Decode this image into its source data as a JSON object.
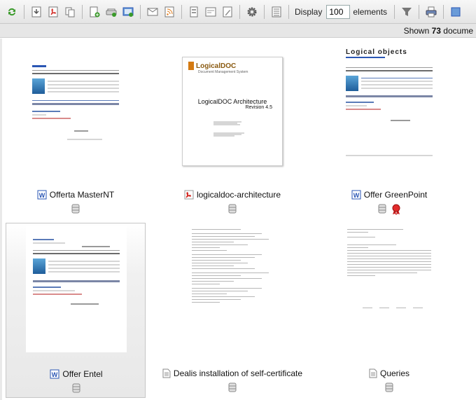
{
  "toolbar": {
    "display_label": "Display",
    "display_value": "100",
    "elements_label": "elements"
  },
  "status": {
    "prefix": "Shown ",
    "count": "73",
    "suffix": " docume"
  },
  "documents": [
    {
      "title": "Offerta MasterNT",
      "type": "word"
    },
    {
      "title": "logicaldoc-architecture",
      "type": "pdf",
      "thumb_heading": "LogicalDOC Architecture",
      "thumb_sub": "Revision 4.5",
      "thumb_logo": "LogicalDOC",
      "thumb_tag": "Document Management System"
    },
    {
      "title": "Offer GreenPoint",
      "type": "word",
      "thumb_logo": "Logical objects",
      "signed": true
    },
    {
      "title": "Offer Entel",
      "type": "word",
      "selected": true
    },
    {
      "title": "Dealis installation of self-certificate",
      "type": "text"
    },
    {
      "title": "Queries",
      "type": "text"
    }
  ],
  "colors": {
    "accent_blue": "#2a56b4",
    "pdf_red": "#d0211b",
    "refresh_green": "#3a9a2a"
  }
}
